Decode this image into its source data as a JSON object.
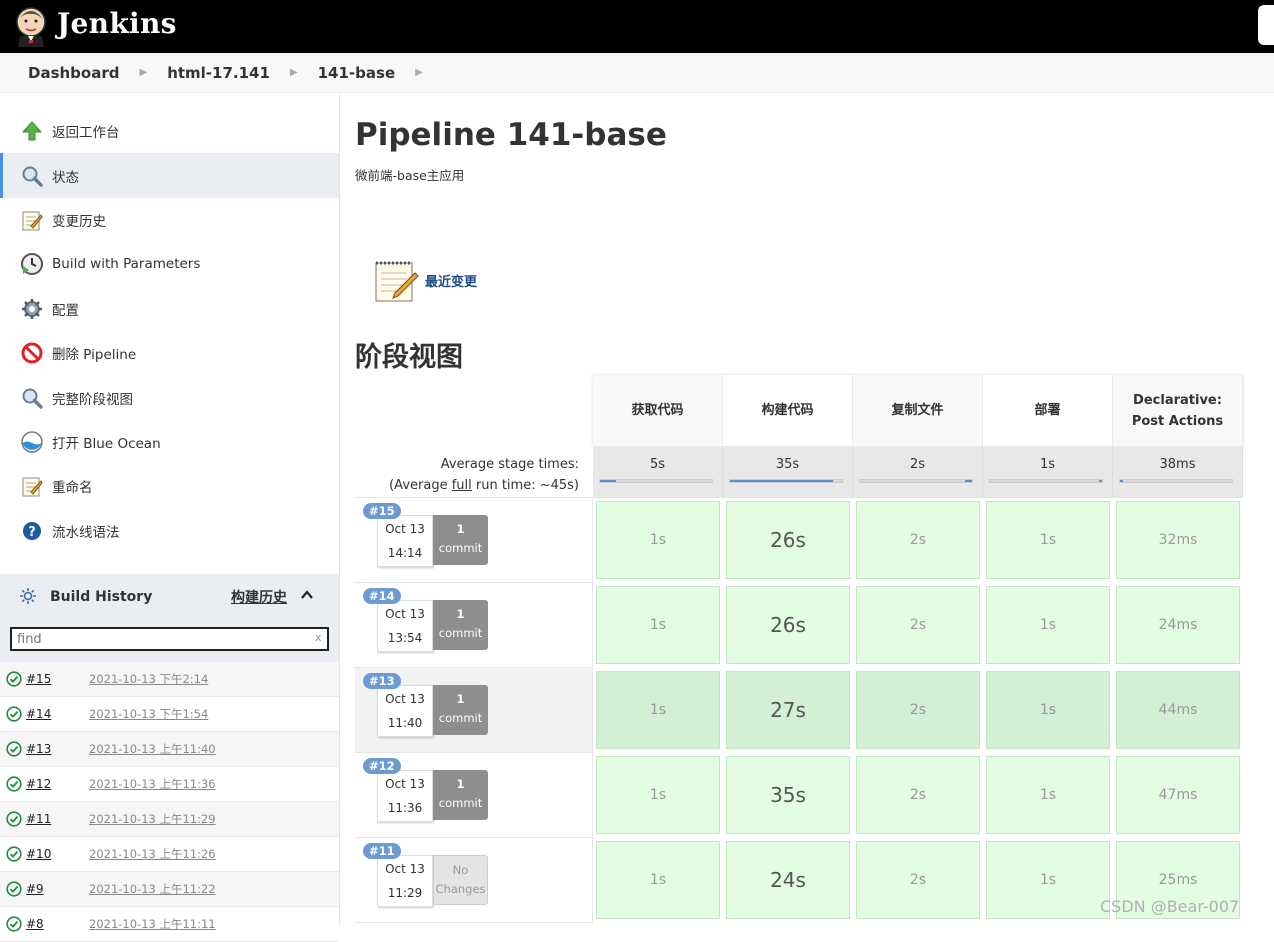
{
  "app": {
    "name": "Jenkins"
  },
  "breadcrumb": [
    "Dashboard",
    "html-17.141",
    "141-base"
  ],
  "sidebar": {
    "tasks": [
      {
        "label": "返回工作台",
        "icon": "arrow-up-icon"
      },
      {
        "label": "状态",
        "icon": "search-icon",
        "active": true
      },
      {
        "label": "变更历史",
        "icon": "notepad-icon"
      },
      {
        "label": "Build with Parameters",
        "icon": "clock-icon"
      },
      {
        "label": "配置",
        "icon": "gear-icon"
      },
      {
        "label": "删除 Pipeline",
        "icon": "no-entry-icon"
      },
      {
        "label": "完整阶段视图",
        "icon": "search-icon"
      },
      {
        "label": "打开 Blue Ocean",
        "icon": "blue-ocean-icon"
      },
      {
        "label": "重命名",
        "icon": "notepad-icon"
      },
      {
        "label": "流水线语法",
        "icon": "help-icon"
      }
    ],
    "build_history": {
      "title": "Build History",
      "trend_link": "构建历史",
      "search_placeholder": "find",
      "builds": [
        {
          "number": "#15",
          "date": "2021-10-13 下午2:14"
        },
        {
          "number": "#14",
          "date": "2021-10-13 下午1:54"
        },
        {
          "number": "#13",
          "date": "2021-10-13 上午11:40"
        },
        {
          "number": "#12",
          "date": "2021-10-13 上午11:36"
        },
        {
          "number": "#11",
          "date": "2021-10-13 上午11:29"
        },
        {
          "number": "#10",
          "date": "2021-10-13 上午11:26"
        },
        {
          "number": "#9",
          "date": "2021-10-13 上午11:22"
        },
        {
          "number": "#8",
          "date": "2021-10-13 上午11:11"
        }
      ]
    }
  },
  "main": {
    "title": "Pipeline 141-base",
    "description": "微前端-base主应用",
    "recent_changes": "最近变更",
    "stage_view_title": "阶段视图",
    "avg_label_1": "Average stage times:",
    "avg_label_2_pre": "(Average ",
    "avg_label_2_full": "full",
    "avg_label_2_post": " run time: ~45s)",
    "stages": [
      {
        "name": "获取代码",
        "avg": "5s",
        "avg_fraction": 0.14
      },
      {
        "name": "构建代码",
        "avg": "35s",
        "avg_fraction": 0.92
      },
      {
        "name": "复制文件",
        "avg": "2s",
        "avg_fraction": 0.06
      },
      {
        "name": "部署",
        "avg": "1s",
        "avg_fraction": 0.03
      },
      {
        "name": "Declarative:\nPost Actions",
        "avg": "38ms",
        "avg_fraction": 0.01
      }
    ],
    "runs": [
      {
        "id": "#15",
        "month_day": "Oct 13",
        "time": "14:14",
        "commit_count": "1",
        "commit_word": "commit",
        "times": [
          "1s",
          "26s",
          "2s",
          "1s",
          "32ms"
        ]
      },
      {
        "id": "#14",
        "month_day": "Oct 13",
        "time": "13:54",
        "commit_count": "1",
        "commit_word": "commit",
        "times": [
          "1s",
          "26s",
          "2s",
          "1s",
          "24ms"
        ]
      },
      {
        "id": "#13",
        "month_day": "Oct 13",
        "time": "11:40",
        "commit_count": "1",
        "commit_word": "commit",
        "times": [
          "1s",
          "27s",
          "2s",
          "1s",
          "44ms"
        ]
      },
      {
        "id": "#12",
        "month_day": "Oct 13",
        "time": "11:36",
        "commit_count": "1",
        "commit_word": "commit",
        "times": [
          "1s",
          "35s",
          "2s",
          "1s",
          "47ms"
        ]
      },
      {
        "id": "#11",
        "month_day": "Oct 13",
        "time": "11:29",
        "commit_count": "No",
        "commit_word": "Changes",
        "no_changes": true,
        "times": [
          "1s",
          "24s",
          "2s",
          "1s",
          "25ms"
        ]
      }
    ]
  },
  "watermark": "CSDN @Bear-007"
}
